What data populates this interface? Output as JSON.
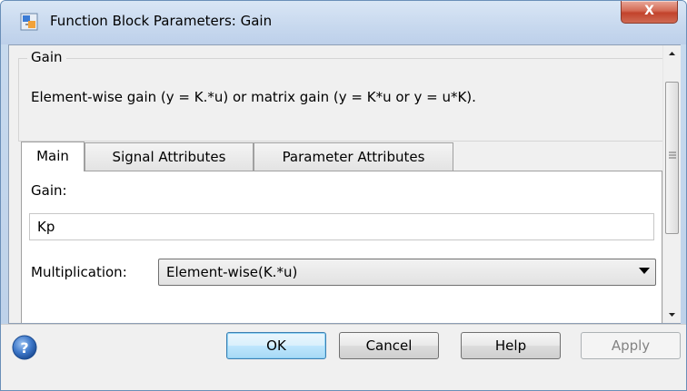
{
  "window": {
    "title": "Function Block Parameters: Gain",
    "close_glyph": "X"
  },
  "section": {
    "title": "Gain",
    "description": "Element-wise gain (y = K.*u) or matrix gain (y = K*u or y = u*K)."
  },
  "tabs": [
    {
      "label": "Main",
      "active": true
    },
    {
      "label": "Signal Attributes",
      "active": false
    },
    {
      "label": "Parameter Attributes",
      "active": false
    }
  ],
  "main": {
    "gain_label": "Gain:",
    "gain_value": "Kp",
    "multiplication_label": "Multiplication:",
    "multiplication_value": "Element-wise(K.*u)"
  },
  "buttons": {
    "ok": "OK",
    "cancel": "Cancel",
    "help": "Help",
    "apply": "Apply"
  },
  "icons": {
    "app": "simulink-block-icon",
    "help": "question-icon",
    "dropdown": "chevron-down-icon"
  }
}
